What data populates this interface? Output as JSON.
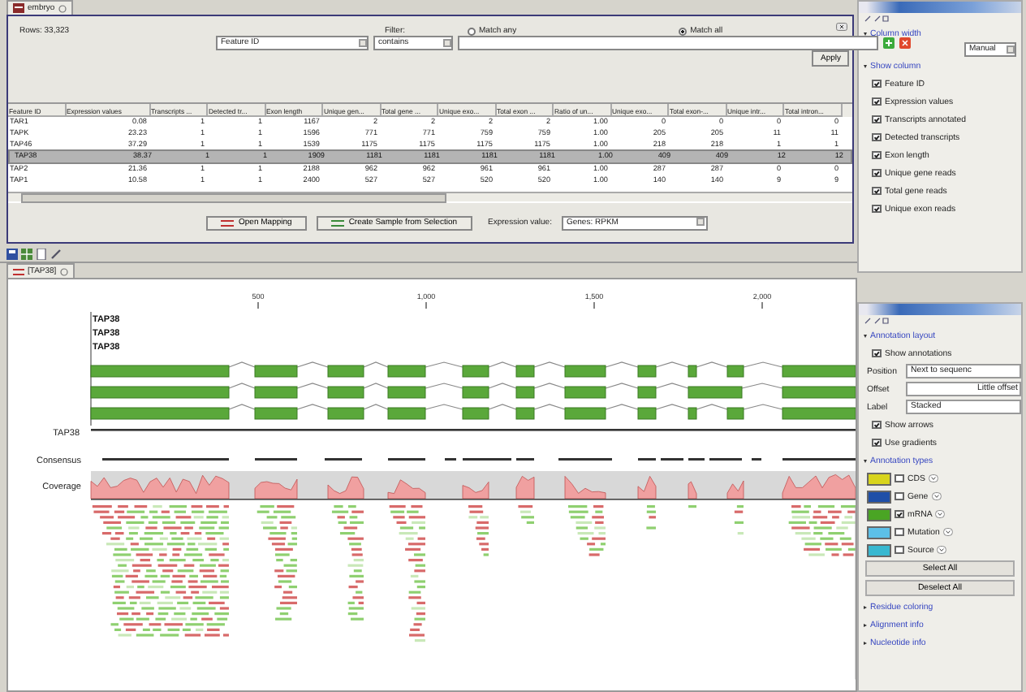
{
  "table_view": {
    "tab": {
      "label": "embryo",
      "selected": true
    },
    "rows_count": "Rows: 33,323",
    "filter": {
      "label": "Filter:",
      "field": "Feature ID",
      "operator": "contains",
      "match": [
        {
          "label": "Match any",
          "selected": false
        },
        {
          "label": "Match all",
          "selected": true
        }
      ],
      "apply": "Apply"
    },
    "table": {
      "columns": [
        "Feature ID",
        "Expression values",
        "Transcripts ...",
        "Detected tr...",
        "Exon length",
        "Unique gen...",
        "Total gene ...",
        "Unique exo...",
        "Total exon ...",
        "Ratio of un...",
        "Unique exo...",
        "Total exon-...",
        "Unique intr...",
        "Total intron..."
      ],
      "rows": [
        {
          "selected": false,
          "cells": [
            "TAR1",
            "0.08",
            "1",
            "1",
            "1167",
            "2",
            "2",
            "2",
            "2",
            "1.00",
            "0",
            "0",
            "0",
            "0"
          ]
        },
        {
          "selected": false,
          "cells": [
            "TAPK",
            "23.23",
            "1",
            "1",
            "1596",
            "771",
            "771",
            "759",
            "759",
            "1.00",
            "205",
            "205",
            "11",
            "11"
          ]
        },
        {
          "selected": false,
          "cells": [
            "TAP46",
            "37.29",
            "1",
            "1",
            "1539",
            "1175",
            "1175",
            "1175",
            "1175",
            "1.00",
            "218",
            "218",
            "1",
            "1"
          ]
        },
        {
          "selected": true,
          "cells": [
            "TAP38",
            "38.37",
            "1",
            "1",
            "1909",
            "1181",
            "1181",
            "1181",
            "1181",
            "1.00",
            "409",
            "409",
            "12",
            "12"
          ]
        },
        {
          "selected": false,
          "cells": [
            "TAP2",
            "21.36",
            "1",
            "1",
            "2188",
            "962",
            "962",
            "961",
            "961",
            "1.00",
            "287",
            "287",
            "0",
            "0"
          ]
        },
        {
          "selected": false,
          "cells": [
            "TAP1",
            "10.58",
            "1",
            "1",
            "2400",
            "527",
            "527",
            "520",
            "520",
            "1.00",
            "140",
            "140",
            "9",
            "9"
          ]
        }
      ]
    },
    "buttons": [
      "Open Mapping",
      "Create Sample from Selection"
    ],
    "expression_value": {
      "label": "Expression value:",
      "value": "Genes: RPKM"
    }
  },
  "column_settings": {
    "column_width": {
      "title": "Column width",
      "expanded": true,
      "value": "Manual"
    },
    "show_column": {
      "title": "Show column",
      "expanded": true,
      "items": [
        {
          "label": "Feature ID",
          "checked": true
        },
        {
          "label": "Expression values",
          "checked": true
        },
        {
          "label": "Transcripts annotated",
          "checked": true
        },
        {
          "label": "Detected transcripts",
          "checked": true
        },
        {
          "label": "Exon length",
          "checked": true
        },
        {
          "label": "Unique gene reads",
          "checked": true
        },
        {
          "label": "Total gene reads",
          "checked": true
        },
        {
          "label": "Unique exon reads",
          "checked": true
        }
      ]
    }
  },
  "viewer": {
    "tab": {
      "label": "[TAP38]",
      "selected": true
    },
    "ruler": [
      "500",
      "1,000",
      "1,500",
      "2,000"
    ],
    "transcripts": [
      "TAP38",
      "TAP38",
      "TAP38"
    ],
    "gene": "TAP38",
    "consensus": "Consensus",
    "coverage": "Coverage"
  },
  "mapping_settings": {
    "layout": {
      "title": "Annotation layout",
      "expanded": true,
      "show_annotations": {
        "label": "Show annotations",
        "checked": true
      },
      "fields": [
        {
          "label": "Position",
          "value": "Next to sequenc"
        },
        {
          "label": "Offset",
          "value": "Little offset"
        },
        {
          "label": "Label",
          "value": "Stacked"
        }
      ],
      "options": [
        {
          "label": "Show arrows",
          "checked": true
        },
        {
          "label": "Use gradients",
          "checked": true
        }
      ]
    },
    "types": {
      "title": "Annotation types",
      "expanded": true,
      "items": [
        {
          "label": "CDS",
          "color": "#d8d41c",
          "checked": false
        },
        {
          "label": "Gene",
          "color": "#1f4fa8",
          "checked": false
        },
        {
          "label": "mRNA",
          "color": "#4aa524",
          "checked": true
        },
        {
          "label": "Mutation",
          "color": "#5cc0e8",
          "checked": false
        },
        {
          "label": "Source",
          "color": "#38b8d0",
          "checked": false
        }
      ],
      "buttons": [
        "Select All",
        "Deselect All"
      ]
    },
    "sections": [
      {
        "title": "Residue coloring",
        "expanded": false
      },
      {
        "title": "Alignment info",
        "expanded": false
      },
      {
        "title": "Nucleotide info",
        "expanded": false
      }
    ]
  }
}
